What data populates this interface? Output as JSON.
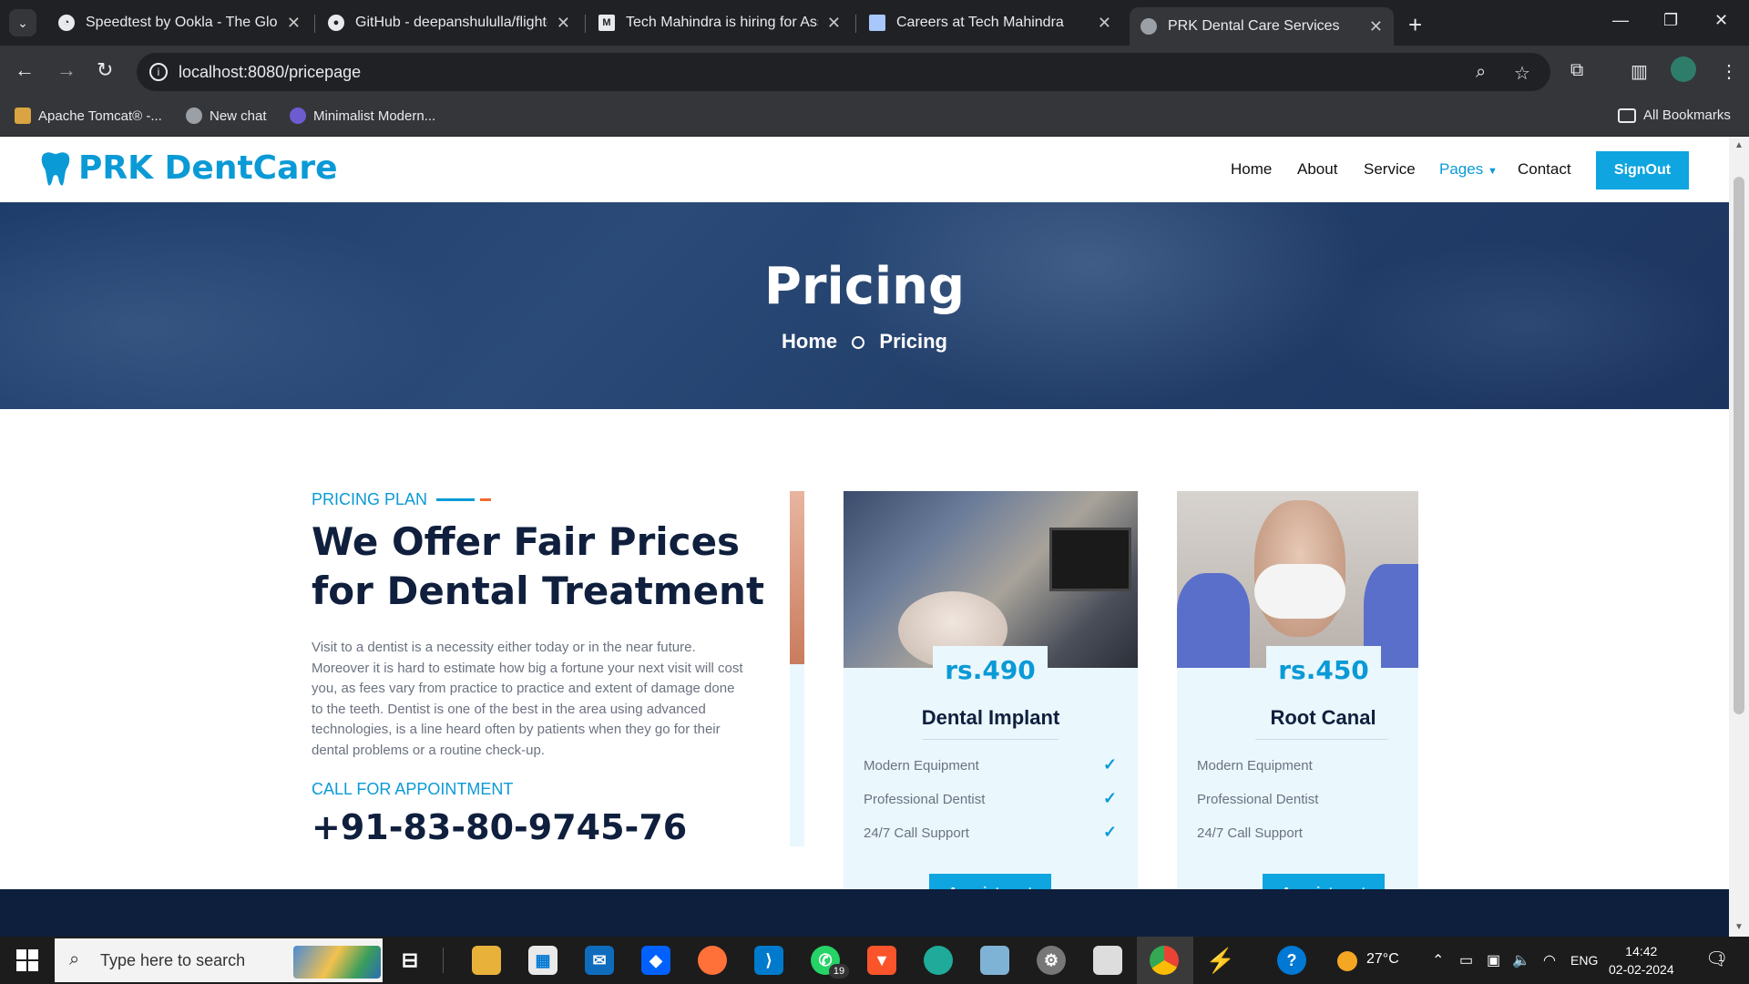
{
  "browser": {
    "tabs": [
      {
        "title": "Speedtest by Ookla - The Global"
      },
      {
        "title": "GitHub - deepanshululla/flight-"
      },
      {
        "title": "Tech Mahindra is hiring for Asso"
      },
      {
        "title": "Careers at Tech Mahindra"
      },
      {
        "title": "PRK Dental Care Services"
      }
    ],
    "url": "localhost:8080/pricepage",
    "bookmarks": [
      {
        "label": "Apache Tomcat® -..."
      },
      {
        "label": "New chat"
      },
      {
        "label": "Minimalist Modern..."
      }
    ],
    "all_bookmarks": "All Bookmarks"
  },
  "site": {
    "brand": "PRK DentCare",
    "brand_color": "#0a9ad6",
    "nav": [
      "Home",
      "About",
      "Service",
      "Pages",
      "Contact"
    ],
    "signout": "SignOut"
  },
  "hero": {
    "title": "Pricing",
    "crumb_home": "Home",
    "crumb_current": "Pricing"
  },
  "pricing": {
    "label": "PRICING PLAN",
    "headline": "We Offer Fair Prices for Dental Treatment",
    "paragraph": "Visit to a dentist is a necessity either today or in the near future. Moreover it is hard to estimate how big a fortune your next visit will cost you, as fees vary from practice to practice and extent of damage done to the teeth. Dentist is one of the best in the area using advanced technologies, is a line heard often by patients when they go for their dental problems or a routine check-up.",
    "call_label": "CALL FOR APPOINTMENT",
    "phone": "+91-83-80-9745-76"
  },
  "plans": [
    {
      "price": "rs.490",
      "name": "Dental Implant",
      "features": [
        "Modern Equipment",
        "Professional Dentist",
        "24/7 Call Support"
      ],
      "button": "Appointment"
    },
    {
      "price": "rs.450",
      "name": "Root Canal",
      "features": [
        "Modern Equipment",
        "Professional Dentist",
        "24/7 Call Support"
      ],
      "button": "Appointment"
    }
  ],
  "taskbar": {
    "search_placeholder": "Type here to search",
    "whatsapp_badge": "19",
    "temperature": "27°C",
    "language": "ENG",
    "time": "14:42",
    "date": "02-02-2024",
    "notifications": "1"
  }
}
